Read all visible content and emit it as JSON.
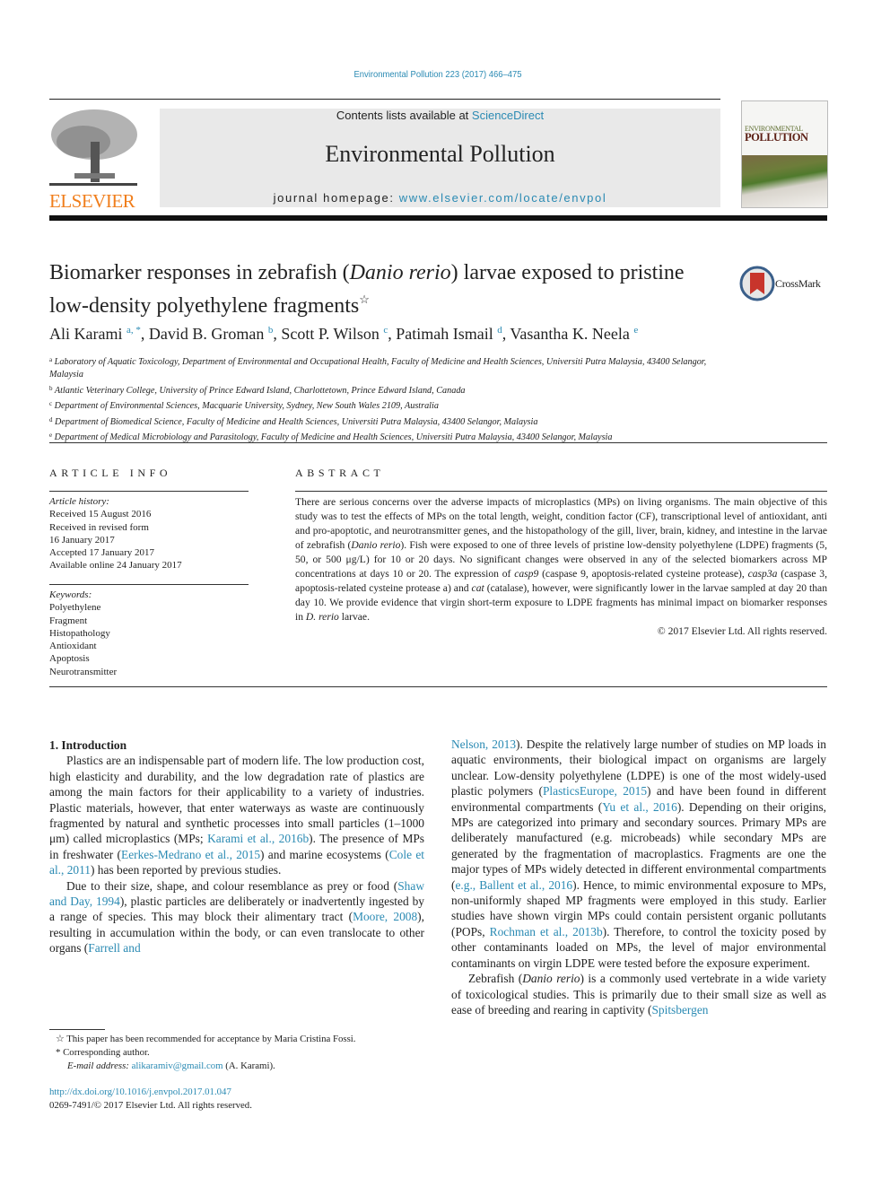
{
  "header": {
    "journal_reference": "Environmental Pollution 223 (2017) 466–475",
    "contents_prefix": "Contents lists available at ",
    "contents_link": "ScienceDirect",
    "journal_title": "Environmental Pollution",
    "homepage_prefix": "journal homepage: ",
    "homepage_link": "www.elsevier.com/locate/envpol",
    "publisher_logo": "ELSEVIER",
    "cover_title_line1": "ENVIRONMENTAL",
    "cover_title_line2": "POLLUTION",
    "crossmark_label": "CrossMark"
  },
  "colors": {
    "link": "#2a8ab3",
    "elsevier_orange": "#f07e1c",
    "masthead_bg": "#e9e9e9"
  },
  "article": {
    "title_part1": "Biomarker responses in zebrafish (",
    "title_italic": "Danio rerio",
    "title_part2": ") larvae exposed to pristine low-density polyethylene fragments",
    "title_mark": "☆",
    "authors": [
      {
        "name": "Ali Karami",
        "sup": "a, *",
        "sep": ", "
      },
      {
        "name": "David B. Groman",
        "sup": "b",
        "sep": ", "
      },
      {
        "name": "Scott P. Wilson",
        "sup": "c",
        "sep": ", "
      },
      {
        "name": "Patimah Ismail",
        "sup": "d",
        "sep": ", "
      },
      {
        "name": "Vasantha K. Neela",
        "sup": "e",
        "sep": ""
      }
    ],
    "affiliations": [
      {
        "key": "a",
        "text": "Laboratory of Aquatic Toxicology, Department of Environmental and Occupational Health, Faculty of Medicine and Health Sciences, Universiti Putra Malaysia, 43400 Selangor, Malaysia"
      },
      {
        "key": "b",
        "text": "Atlantic Veterinary College, University of Prince Edward Island, Charlottetown, Prince Edward Island, Canada"
      },
      {
        "key": "c",
        "text": "Department of Environmental Sciences, Macquarie University, Sydney, New South Wales 2109, Australia"
      },
      {
        "key": "d",
        "text": "Department of Biomedical Science, Faculty of Medicine and Health Sciences, Universiti Putra Malaysia, 43400 Selangor, Malaysia"
      },
      {
        "key": "e",
        "text": "Department of Medical Microbiology and Parasitology, Faculty of Medicine and Health Sciences, Universiti Putra Malaysia, 43400 Selangor, Malaysia"
      }
    ]
  },
  "article_info": {
    "heading": "ARTICLE INFO",
    "history_label": "Article history:",
    "history": [
      "Received 15 August 2016",
      "Received in revised form",
      "16 January 2017",
      "Accepted 17 January 2017",
      "Available online 24 January 2017"
    ],
    "keywords_label": "Keywords:",
    "keywords": [
      "Polyethylene",
      "Fragment",
      "Histopathology",
      "Antioxidant",
      "Apoptosis",
      "Neurotransmitter"
    ]
  },
  "abstract": {
    "heading": "ABSTRACT",
    "s1": "There are serious concerns over the adverse impacts of microplastics (MPs) on living organisms. The main objective of this study was to test the effects of MPs on the total length, weight, condition factor (CF), transcriptional level of antioxidant, anti and pro-apoptotic, and neurotransmitter genes, and the histopathology of the gill, liver, brain, kidney, and intestine in the larvae of zebrafish (",
    "s1_i": "Danio rerio",
    "s2": "). Fish were exposed to one of three levels of pristine low-density polyethylene (LDPE) fragments (5, 50, or 500 μg/L) for 10 or 20 days. No significant changes were observed in any of the selected biomarkers across MP concentrations at days 10 or 20. The expression of ",
    "s2_i": "casp9",
    "s3": " (caspase 9, apoptosis-related cysteine protease), ",
    "s3_i": "casp3a",
    "s4": " (caspase 3, apoptosis-related cysteine protease a) and ",
    "s4_i": "cat",
    "s5": " (catalase), however, were significantly lower in the larvae sampled at day 20 than day 10. We provide evidence that virgin short-term exposure to LDPE fragments has minimal impact on biomarker responses in ",
    "s5_i": "D. rerio",
    "s6": " larvae.",
    "copyright": "© 2017 Elsevier Ltd. All rights reserved."
  },
  "intro": {
    "heading": "1.  Introduction",
    "p1a": "Plastics are an indispensable part of modern life. The low production cost, high elasticity and durability, and the low degradation rate of plastics are among the main factors for their applicability to a variety of industries. Plastic materials, however, that enter waterways as waste are continuously fragmented by natural and synthetic processes into small particles (1–1000 μm) called microplastics (MPs; ",
    "p1_ref1": "Karami et al., 2016b",
    "p1b": "). The presence of MPs in freshwater (",
    "p1_ref2": "Eerkes-Medrano et al., 2015",
    "p1c": ") and marine ecosystems (",
    "p1_ref3": "Cole et al., 2011",
    "p1d": ") has been reported by previous studies.",
    "p2a": "Due to their size, shape, and colour resemblance as prey or food (",
    "p2_ref1": "Shaw and Day, 1994",
    "p2b": "), plastic particles are deliberately or inadvertently ingested by a range of species. This may block their alimentary tract (",
    "p2_ref2": "Moore, 2008",
    "p2c": "), resulting in accumulation within the body, or can even translocate to other organs (",
    "p2_ref3a": "Farrell and",
    "r_ref0": "Nelson, 2013",
    "r1a": "). Despite the relatively large number of studies on MP loads in aquatic environments, their biological impact on organisms are largely unclear. Low-density polyethylene (LDPE) is one of the most widely-used plastic polymers (",
    "r_ref1": "PlasticsEurope, 2015",
    "r1b": ") and have been found in different environmental compartments (",
    "r_ref2": "Yu et al., 2016",
    "r1c": "). Depending on their origins, MPs are categorized into primary and secondary sources. Primary MPs are deliberately manufactured (e.g. microbeads) while secondary MPs are generated by the fragmentation of macroplastics. Fragments are one the major types of MPs widely detected in different environmental compartments (",
    "r_ref3": "e.g., Ballent et al., 2016",
    "r1d": "). Hence, to mimic environmental exposure to MPs, non-uniformly shaped MP fragments were employed in this study. Earlier studies have shown virgin MPs could contain persistent organic pollutants (POPs, ",
    "r_ref4": "Rochman et al., 2013b",
    "r1e": "). Therefore, to control the toxicity posed by other contaminants loaded on MPs, the level of major environmental contaminants on virgin LDPE were tested before the exposure experiment.",
    "r2a": "Zebrafish (",
    "r2_i": "Danio rerio",
    "r2b": ") is a commonly used vertebrate in a wide variety of toxicological studies. This is primarily due to their small size as well as ease of breeding and rearing in captivity (",
    "r2_ref": "Spitsbergen"
  },
  "footnotes": {
    "star_mark": "☆",
    "star_text": " This paper has been recommended for acceptance by Maria Cristina Fossi.",
    "corr_mark": "*",
    "corr_text": " Corresponding author.",
    "email_label": "E-mail address: ",
    "email": "alikaramiv@gmail.com",
    "email_suffix": " (A. Karami).",
    "doi": "http://dx.doi.org/10.1016/j.envpol.2017.01.047",
    "issn_line": "0269-7491/© 2017 Elsevier Ltd. All rights reserved."
  }
}
